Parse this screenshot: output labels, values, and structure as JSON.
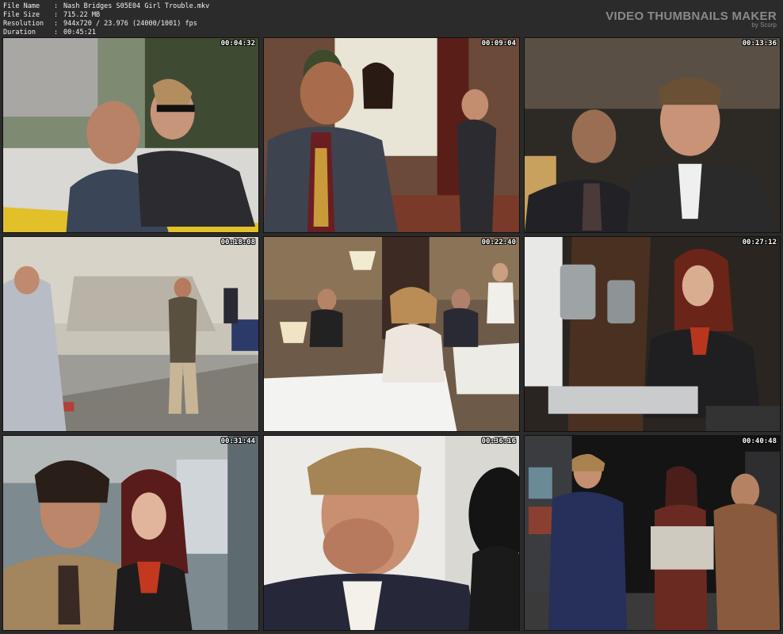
{
  "info": {
    "rows": [
      {
        "label": "File Name",
        "value": "Nash Bridges S05E04 Girl Trouble.mkv"
      },
      {
        "label": "File Size",
        "value": "715.22 MB"
      },
      {
        "label": "Resolution",
        "value": "944x720 / 23.976 (24000/1001) fps"
      },
      {
        "label": "Duration",
        "value": "00:45:21"
      }
    ],
    "separator": ":"
  },
  "brand": {
    "title": "VIDEO THUMBNAILS MAKER",
    "subtitle": "by Scorp"
  },
  "thumbnails": [
    {
      "timestamp": "00:04:32",
      "icon": "car-scene"
    },
    {
      "timestamp": "00:09:04",
      "icon": "lobby-scene"
    },
    {
      "timestamp": "00:13:36",
      "icon": "hall-scene"
    },
    {
      "timestamp": "00:18:08",
      "icon": "street-scene"
    },
    {
      "timestamp": "00:22:40",
      "icon": "restaurant-scene"
    },
    {
      "timestamp": "00:27:12",
      "icon": "lab-scene"
    },
    {
      "timestamp": "00:31:44",
      "icon": "closeup-scene"
    },
    {
      "timestamp": "00:36:16",
      "icon": "laughing-scene"
    },
    {
      "timestamp": "00:40:48",
      "icon": "night-street-scene"
    }
  ]
}
